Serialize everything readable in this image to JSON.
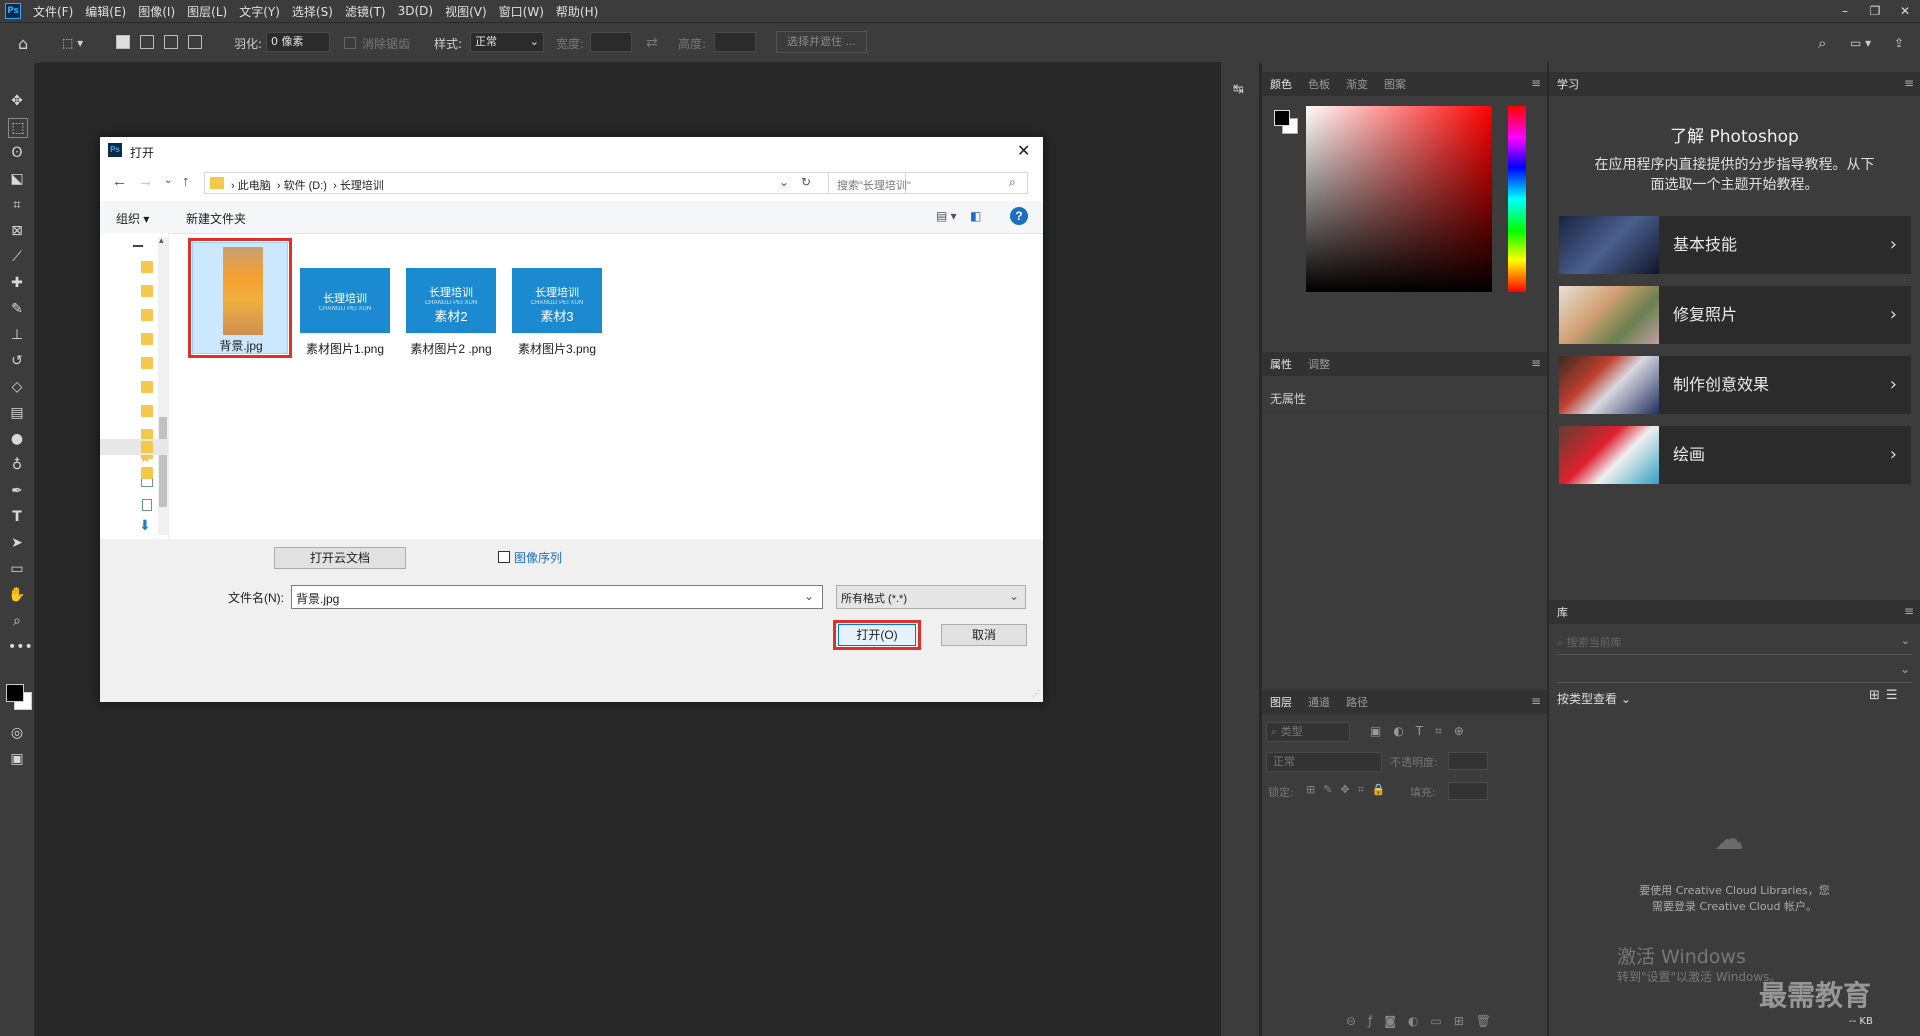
{
  "app": {
    "logo": "Ps",
    "menus": [
      "文件(F)",
      "编辑(E)",
      "图像(I)",
      "图层(L)",
      "文字(Y)",
      "选择(S)",
      "滤镜(T)",
      "3D(D)",
      "视图(V)",
      "窗口(W)",
      "帮助(H)"
    ],
    "window_controls": [
      "–",
      "❐",
      "✕"
    ]
  },
  "options": {
    "feather_label": "羽化:",
    "feather_value": "0 像素",
    "antialias_label": "消除锯齿",
    "style_label": "样式:",
    "style_value": "正常",
    "width_label": "宽度:",
    "height_label": "高度:",
    "select_mask_label": "选择并遮住 ..."
  },
  "color_panel": {
    "tabs": [
      "颜色",
      "色板",
      "渐变",
      "图案"
    ]
  },
  "properties_panel": {
    "tabs": [
      "属性",
      "调整"
    ],
    "no_properties": "无属性"
  },
  "layers_panel": {
    "tabs": [
      "图层",
      "通道",
      "路径"
    ],
    "kind_placeholder": "类型",
    "blend_mode": "正常",
    "opacity_label": "不透明度:",
    "lock_label": "锁定:",
    "fill_label": "填充:"
  },
  "learn_panel": {
    "tab": "学习",
    "title": "了解 Photoshop",
    "desc_line1": "在应用程序内直接提供的分步指导教程。从下",
    "desc_line2": "面选取一个主题开始教程。",
    "items": [
      {
        "label": "基本技能"
      },
      {
        "label": "修复照片"
      },
      {
        "label": "制作创意效果"
      },
      {
        "label": "绘画"
      }
    ]
  },
  "library_panel": {
    "tab": "库",
    "search_placeholder": "搜索当前库",
    "view_by": "按类型查看",
    "empty_line1": "要使用 Creative Cloud Libraries，您",
    "empty_line2": "需要登录 Creative Cloud 帐户。",
    "size": "-- KB"
  },
  "watermark": {
    "activate": "激活 Windows",
    "activate_sub": "转到\"设置\"以激活 Windows。",
    "brand": "最需教育"
  },
  "dialog": {
    "title": "打开",
    "breadcrumb": [
      "此电脑",
      "软件 (D:)",
      "长理培训"
    ],
    "search_placeholder": "搜索\"长理培训\"",
    "organize": "组织",
    "new_folder": "新建文件夹",
    "files": [
      {
        "name": "背景.jpg",
        "selected": true
      },
      {
        "name": "素材图片1.png",
        "thumb_title": "长理培训",
        "thumb_sub": "CHANGLI PEI XUN",
        "thumb_big": ""
      },
      {
        "name": "素材图片2 .png",
        "thumb_title": "长理培训",
        "thumb_sub": "CHANGLI PEI XUN",
        "thumb_big": "素材2"
      },
      {
        "name": "素材图片3.png",
        "thumb_title": "长理培训",
        "thumb_sub": "CHANGLI PEI XUN",
        "thumb_big": "素材3"
      }
    ],
    "open_cloud": "打开云文档",
    "image_sequence": "图像序列",
    "filename_label": "文件名(N):",
    "filename_value": "背景.jpg",
    "format_value": "所有格式 (*.*)",
    "open_button": "打开(O)",
    "cancel_button": "取消"
  },
  "colors": {
    "highlight_red": "#e0302a",
    "ps_blue": "#31a8ff",
    "thumb_blue": "#1b8ad0"
  }
}
